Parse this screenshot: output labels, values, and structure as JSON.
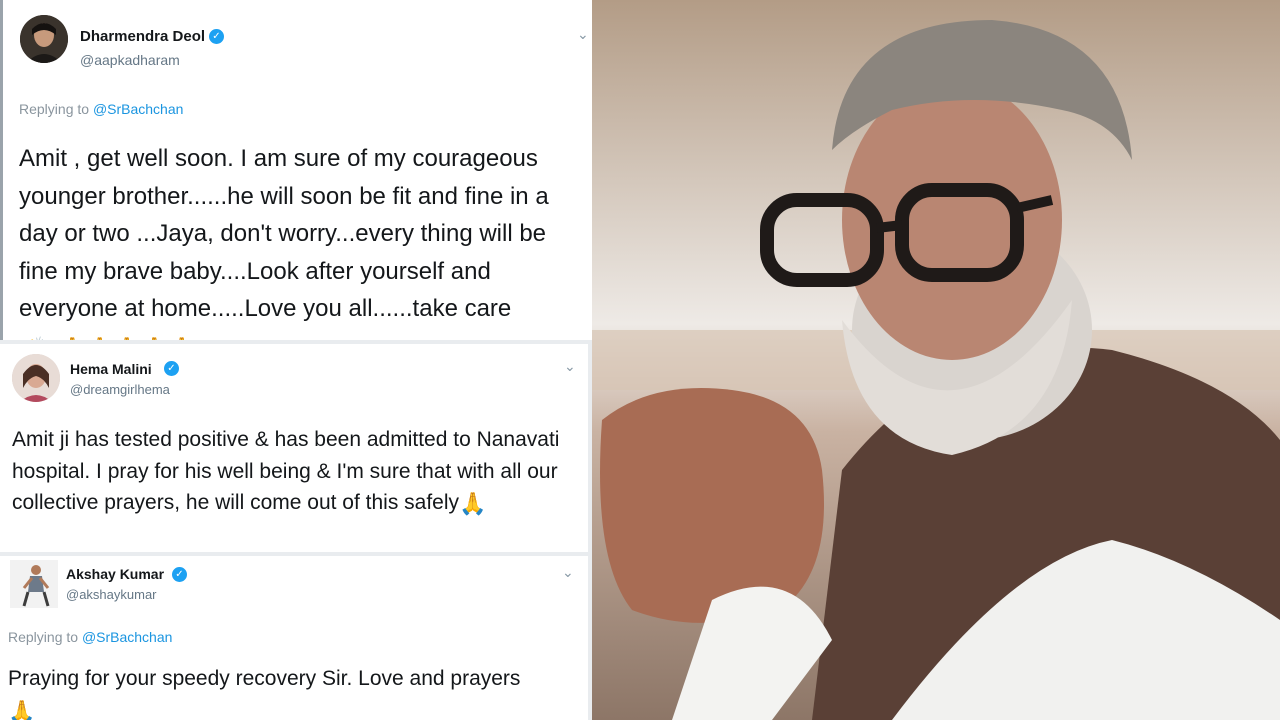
{
  "tweets": [
    {
      "name": "Dharmendra Deol",
      "handle": "@aapkadharam",
      "replying_prefix": "Replying to ",
      "replying_to": "@SrBachchan",
      "text": "Amit , get well soon. I am sure of my courageous younger brother......he will soon   be fit and fine in a day or two ...Jaya, don't worry...every thing will be fine my brave baby....Look after yourself and everyone at home.....Love you all......take care ",
      "emojis": "👏. 🙏🙏🙏🙏🙏"
    },
    {
      "name": "Hema Malini",
      "handle": "@dreamgirlhema",
      "text": "Amit ji has tested positive & has been admitted to Nanavati hospital. I pray for his well being & I'm sure that with all our collective prayers, he will come out of this safely",
      "emojis": "🙏"
    },
    {
      "name": "Akshay Kumar",
      "handle": "@akshaykumar",
      "replying_prefix": "Replying to ",
      "replying_to": "@SrBachchan",
      "text": "Praying for your speedy recovery Sir. Love and prayers",
      "emojis": "🙏"
    }
  ],
  "icons": {
    "verified": "verified-badge-icon",
    "caret": "chevron-down-icon"
  },
  "colors": {
    "verified_blue": "#1da1f2",
    "mention_blue": "#1b95e0",
    "handle_gray": "#657786"
  }
}
